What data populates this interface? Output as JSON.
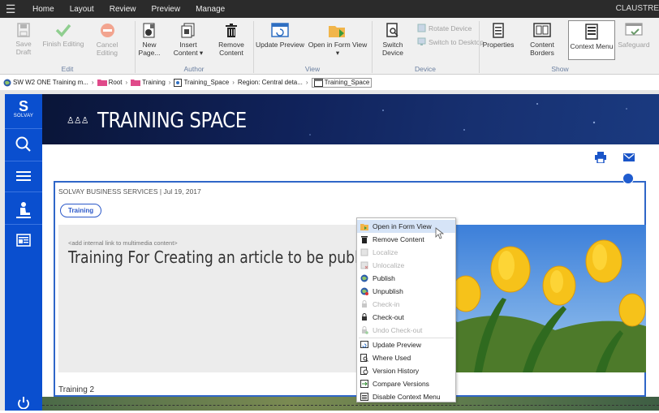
{
  "topbar": {
    "menus": [
      "Home",
      "Layout",
      "Review",
      "Preview",
      "Manage"
    ],
    "user": "CLAUSTRE"
  },
  "ribbon": {
    "groups": {
      "edit": "Edit",
      "author": "Author",
      "view": "View",
      "device": "Device",
      "show": "Show"
    },
    "buttons": {
      "save_draft": "Save Draft",
      "finish_editing": "Finish Editing",
      "cancel_editing_1": "Cancel",
      "cancel_editing_2": "Editing",
      "new_page_1": "New",
      "new_page_2": "Page...",
      "insert_content_1": "Insert",
      "insert_content_2": "Content ▾",
      "remove_content_1": "Remove",
      "remove_content_2": "Content",
      "update_preview": "Update Preview",
      "open_form_view": "Open in Form View ▾",
      "switch_device": "Switch Device",
      "rotate_device": "Rotate Device",
      "switch_desktop": "Switch to Desktop",
      "properties": "Properties",
      "content_borders": "Content Borders",
      "context_menu": "Context Menu",
      "safeguard": "Safeguard"
    }
  },
  "breadcrumb": [
    "SW W2 ONE Training m...",
    "Root",
    "Training",
    "Training_Space",
    "Region: Central deta...",
    "Training_Space"
  ],
  "nav": {
    "logo_letter": "S",
    "logo_name": "SOLVAY"
  },
  "banner": {
    "title": "TRAINING SPACE"
  },
  "article": {
    "meta": "SOLVAY BUSINESS SERVICES  |  Jul 19, 2017",
    "tag": "Training",
    "link_hint": "<add internal link to multimedia content>",
    "headline": "Training For Creating an article to be published",
    "footer": "Training 2"
  },
  "context_menu": {
    "items": [
      {
        "label": "Open in Form View",
        "icon": "form-view-icon",
        "enabled": true
      },
      {
        "label": "Remove Content",
        "icon": "trash-icon",
        "enabled": true
      },
      {
        "label": "Localize",
        "icon": "localize-icon",
        "enabled": false
      },
      {
        "label": "Unlocalize",
        "icon": "unlocalize-icon",
        "enabled": false
      },
      {
        "label": "Publish",
        "icon": "publish-globe-icon",
        "enabled": true
      },
      {
        "label": "Unpublish",
        "icon": "unpublish-globe-icon",
        "enabled": true
      },
      {
        "label": "Check-in",
        "icon": "lock-icon",
        "enabled": false
      },
      {
        "label": "Check-out",
        "icon": "lock-icon",
        "enabled": true
      },
      {
        "label": "Undo Check-out",
        "icon": "undo-lock-icon",
        "enabled": false
      },
      {
        "label": "Update Preview",
        "icon": "refresh-icon",
        "enabled": true
      },
      {
        "label": "Where Used",
        "icon": "where-used-icon",
        "enabled": true
      },
      {
        "label": "Version History",
        "icon": "history-icon",
        "enabled": true
      },
      {
        "label": "Compare Versions",
        "icon": "compare-icon",
        "enabled": true
      },
      {
        "label": "Disable Context Menu",
        "icon": "menu-icon",
        "enabled": true
      }
    ]
  },
  "colors": {
    "nav_blue": "#0a4fcf",
    "accent": "#2f66c8",
    "highlight": "#d6e4f7"
  }
}
